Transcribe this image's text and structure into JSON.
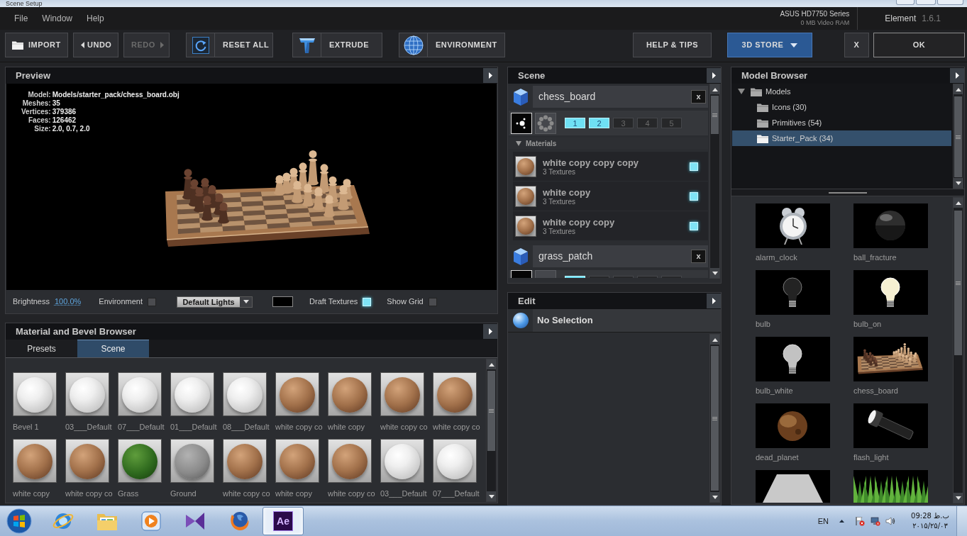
{
  "window": {
    "title": "Scene Setup"
  },
  "menu": [
    "File",
    "Window",
    "Help"
  ],
  "gpu": {
    "name": "ASUS HD7750 Series",
    "memory": "0 MB Video RAM"
  },
  "app": {
    "name": "Element",
    "version": "1.6.1"
  },
  "toolbar": [
    {
      "kind": "import",
      "label": "IMPORT",
      "disabled": false
    },
    {
      "kind": "undo",
      "label": "UNDO",
      "disabled": false
    },
    {
      "kind": "redo",
      "label": "REDO",
      "disabled": true
    },
    {
      "kind": "reset",
      "label": "RESET ALL",
      "disabled": false
    },
    {
      "kind": "extrude",
      "label": "EXTRUDE",
      "disabled": false
    },
    {
      "kind": "environment",
      "label": "ENVIRONMENT",
      "disabled": false
    },
    {
      "kind": "help",
      "label": "HELP & TIPS",
      "disabled": false
    },
    {
      "kind": "store",
      "label": "3D STORE",
      "disabled": false
    },
    {
      "kind": "cancel",
      "label": "X",
      "disabled": false
    },
    {
      "kind": "ok",
      "label": "OK",
      "disabled": false
    }
  ],
  "preview": {
    "title": "Preview",
    "info": [
      {
        "label": "Model:",
        "value": "Models/starter_pack/chess_board.obj"
      },
      {
        "label": "Meshes:",
        "value": "35"
      },
      {
        "label": "Vertices:",
        "value": "379386"
      },
      {
        "label": "Faces:",
        "value": "126462"
      },
      {
        "label": "Size:",
        "value": "2.0, 0.7, 2.0"
      }
    ],
    "controls": {
      "brightness": {
        "label": "Brightness",
        "value": "100.0%"
      },
      "environment": {
        "label": "Environment",
        "checked": false
      },
      "lights": {
        "value": "Default Lights"
      },
      "swatch": {
        "color": "#000000"
      },
      "draft_textures": {
        "label": "Draft Textures",
        "checked": true
      },
      "show_grid": {
        "label": "Show Grid",
        "checked": false
      }
    }
  },
  "material_browser": {
    "title": "Material and Bevel Browser",
    "tabs": [
      {
        "label": "Presets",
        "selected": false
      },
      {
        "label": "Scene",
        "selected": true
      }
    ],
    "items": [
      {
        "name": "Bevel 1",
        "kind": "white"
      },
      {
        "name": "03___Default",
        "kind": "white"
      },
      {
        "name": "07___Default",
        "kind": "white"
      },
      {
        "name": "01___Default",
        "kind": "white"
      },
      {
        "name": "08___Default",
        "kind": "white"
      },
      {
        "name": "white copy co",
        "kind": "wood"
      },
      {
        "name": "white copy",
        "kind": "wood"
      },
      {
        "name": "white copy co",
        "kind": "wood"
      },
      {
        "name": "white copy co",
        "kind": "wood"
      },
      {
        "name": "white copy",
        "kind": "wood"
      },
      {
        "name": "white copy co",
        "kind": "wood"
      },
      {
        "name": "Grass",
        "kind": "grass"
      },
      {
        "name": "Ground",
        "kind": "gray"
      },
      {
        "name": "white copy co",
        "kind": "wood"
      },
      {
        "name": "white copy",
        "kind": "wood"
      },
      {
        "name": "white copy co",
        "kind": "wood"
      },
      {
        "name": "03___Default",
        "kind": "white"
      },
      {
        "name": "07___Default",
        "kind": "white"
      }
    ]
  },
  "scene": {
    "title": "Scene",
    "objects": [
      {
        "name": "chess_board",
        "close": "x",
        "modes": [
          {
            "kind": "pivot",
            "selected": true
          },
          {
            "kind": "ring",
            "selected": false
          }
        ],
        "lods": [
          {
            "label": "1",
            "selected": true
          },
          {
            "label": "2",
            "selected": true
          },
          {
            "label": "3",
            "selected": false
          },
          {
            "label": "4",
            "selected": false
          },
          {
            "label": "5",
            "selected": false
          }
        ],
        "materials_label": "Materials",
        "expanded": true,
        "materials": [
          {
            "name": "white copy copy copy",
            "textures": "3 Textures",
            "checked": true
          },
          {
            "name": "white copy",
            "textures": "3 Textures",
            "checked": true
          },
          {
            "name": "white copy copy",
            "textures": "3 Textures",
            "checked": true
          }
        ]
      },
      {
        "name": "grass_patch",
        "close": "x",
        "modes": [
          {
            "selected": true
          },
          {
            "selected": false
          }
        ],
        "lods": [
          {
            "selected": true
          },
          {
            "selected": false
          },
          {
            "selected": false
          },
          {
            "selected": false
          },
          {
            "selected": false
          }
        ]
      }
    ]
  },
  "edit": {
    "title": "Edit",
    "selection": "No Selection"
  },
  "model_browser": {
    "title": "Model Browser",
    "tree": [
      {
        "label": "Models",
        "expanded": true,
        "selected": false,
        "children": [
          {
            "label": "Icons (30)",
            "selected": false
          },
          {
            "label": "Primitives (54)",
            "selected": false
          },
          {
            "label": "Starter_Pack (34)",
            "selected": true
          }
        ]
      }
    ],
    "models": [
      {
        "name": "alarm_clock",
        "kind": "clock"
      },
      {
        "name": "ball_fracture",
        "kind": "orb"
      },
      {
        "name": "bulb",
        "kind": "bulb"
      },
      {
        "name": "bulb_on",
        "kind": "glowbulb"
      },
      {
        "name": "bulb_white",
        "kind": "whitebulb"
      },
      {
        "name": "chess_board",
        "kind": "chess"
      },
      {
        "name": "dead_planet",
        "kind": "planet"
      },
      {
        "name": "flash_light",
        "kind": "flashlight"
      },
      {
        "kind": "plane"
      },
      {
        "kind": "grass"
      }
    ]
  },
  "taskbar": {
    "apps": [
      {
        "kind": "browser",
        "selected": false
      },
      {
        "kind": "files",
        "selected": false
      },
      {
        "kind": "media",
        "selected": false
      },
      {
        "kind": "studio",
        "selected": false
      },
      {
        "kind": "firefox",
        "selected": false
      },
      {
        "kind": "ae",
        "label": "Ae",
        "selected": true
      }
    ],
    "language": "EN",
    "time": "09:28 ب.ظ",
    "date": "۲۰۱۵/۲۵/۰۳"
  }
}
